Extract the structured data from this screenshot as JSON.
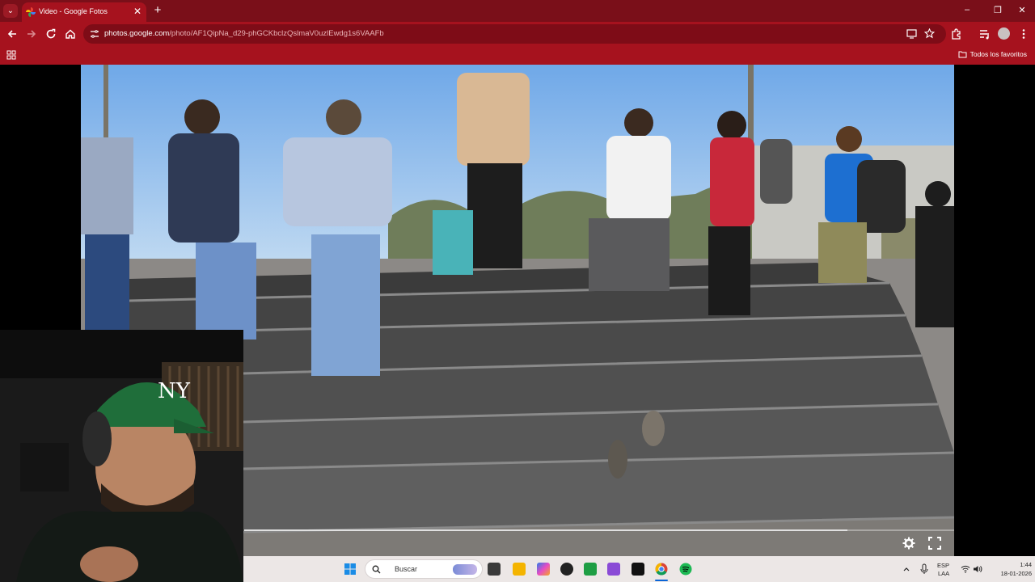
{
  "tab": {
    "title": "Video - Google Fotos",
    "close": "✕",
    "new": "+",
    "menu": "⌄"
  },
  "window_controls": {
    "minimize": "–",
    "restore": "❐",
    "close": "✕"
  },
  "address": {
    "host": "photos.google.com",
    "path": "/photo/AF1QipNa_d29-phGCKbclzQslmaV0uzlEwdg1s6VAAFb"
  },
  "bookmarks": {
    "all_favorites": "Todos los favoritos"
  },
  "video": {
    "progress": 0.85
  },
  "taskbar": {
    "search_placeholder": "Buscar",
    "lang": "ESP",
    "layout": "LAA",
    "time": "1:44",
    "date": "18-01-2026"
  },
  "colors": {
    "chrome_dark": "#7a0f19",
    "chrome": "#a6121e",
    "taskbar": "#ece7e6"
  }
}
